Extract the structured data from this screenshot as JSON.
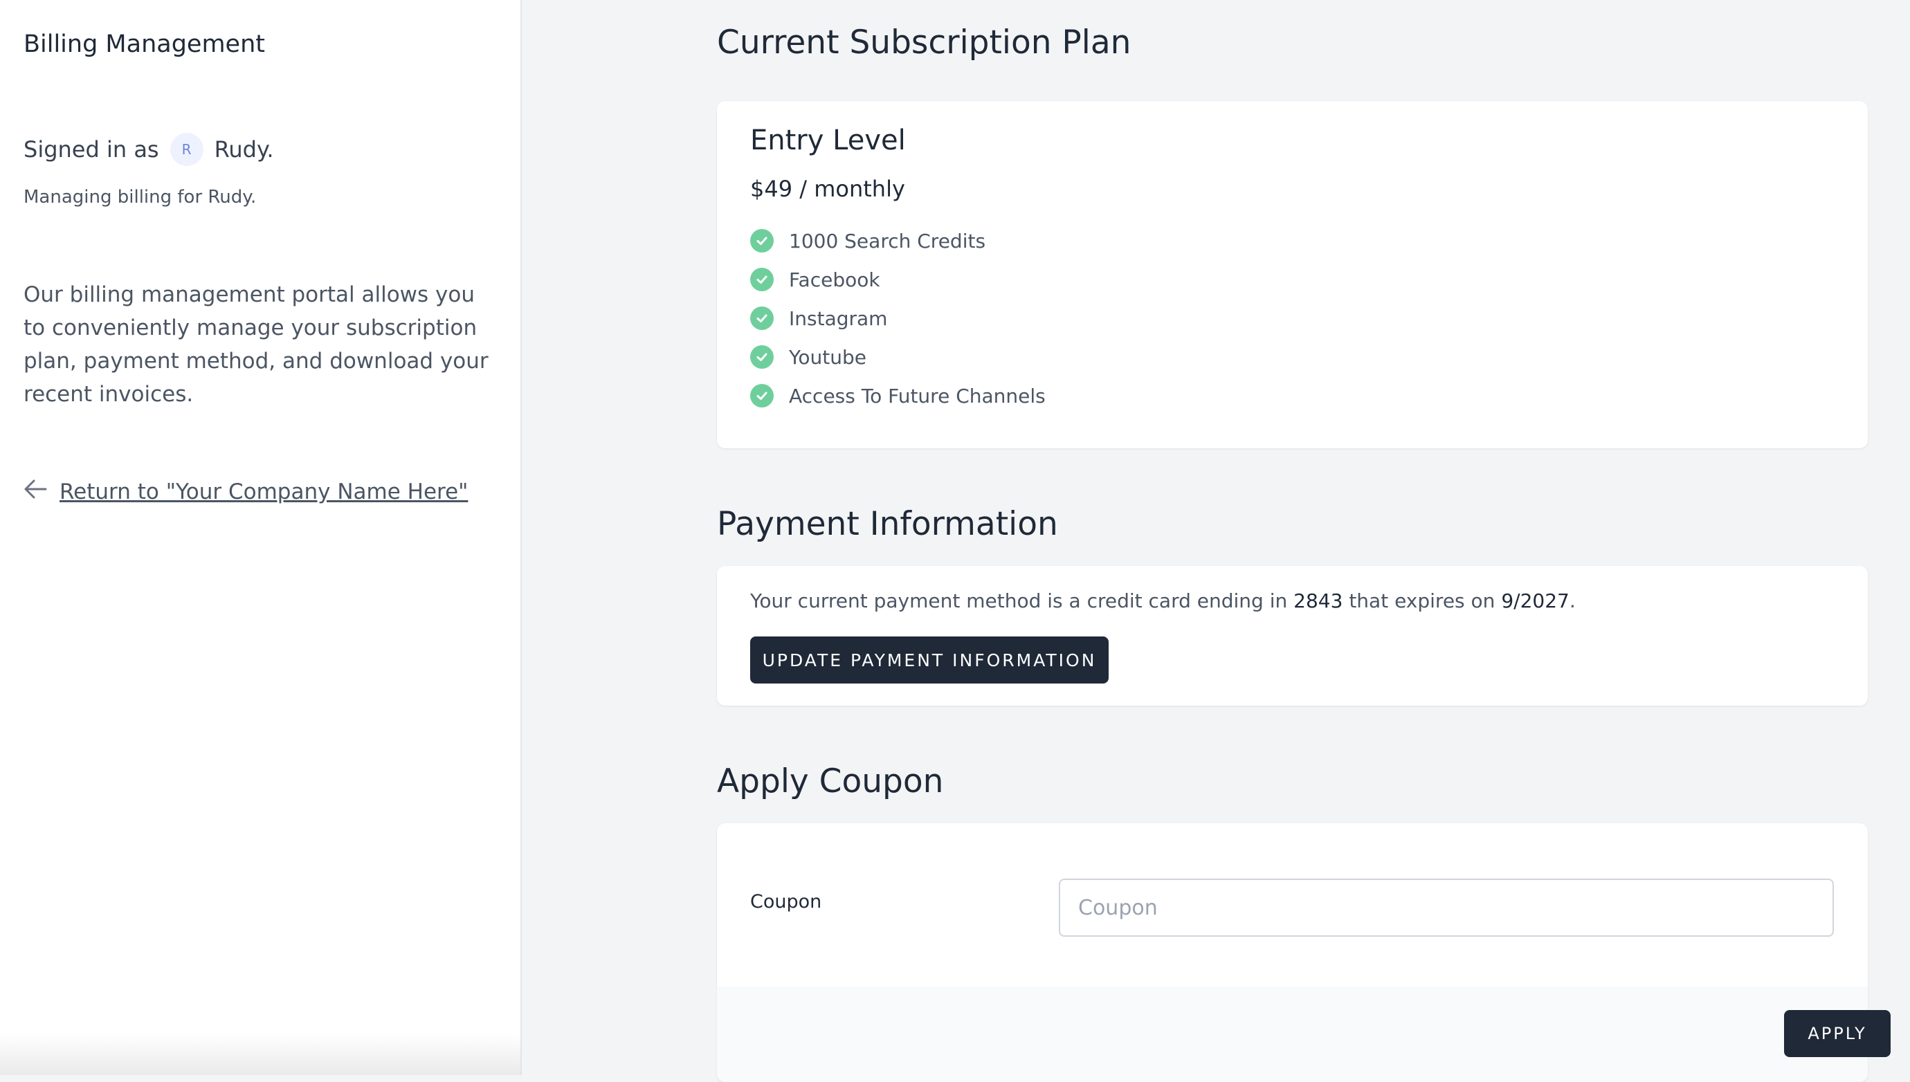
{
  "sidebar": {
    "title": "Billing Management",
    "signed_in_prefix": "Signed in as",
    "avatar_initial": "R",
    "user_name": "Rudy.",
    "managing": "Managing billing for Rudy.",
    "description": "Our billing management portal allows you to conveniently manage your subscription plan, payment method, and download your recent invoices.",
    "return_link": "Return to \"Your Company Name Here\""
  },
  "subscription": {
    "heading": "Current Subscription Plan",
    "plan_name": "Entry Level",
    "price": "$49 / monthly",
    "features": [
      "1000 Search Credits",
      "Facebook",
      "Instagram",
      "Youtube",
      "Access To Future Channels"
    ]
  },
  "payment": {
    "heading": "Payment Information",
    "text_prefix": "Your current payment method is a credit card ending in",
    "card_last4": "2843",
    "text_middle": "that expires on",
    "expiry": "9/2027",
    "text_suffix": ".",
    "update_button": "UPDATE PAYMENT INFORMATION"
  },
  "coupon": {
    "heading": "Apply Coupon",
    "label": "Coupon",
    "placeholder": "Coupon",
    "value": "",
    "apply_button": "APPLY"
  },
  "colors": {
    "accent_dark": "#1f2937",
    "check_green": "#6fcf9c",
    "background": "#f3f4f6"
  }
}
